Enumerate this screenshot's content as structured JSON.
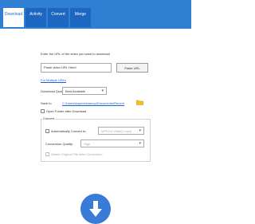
{
  "tabs": [
    "Download",
    "Activity",
    "Convert",
    "Merge"
  ],
  "form": {
    "url_label": "Enter the URL of the video you want to download",
    "url_value": "Paste video URL Here!",
    "paste_button": "Paste URL",
    "multiple_urls_link": "For Multiple URLs",
    "quality_label": "Download Quality",
    "quality_value": "Best Available",
    "save_label": "Save to",
    "save_path": "C:\\Users\\kapeeecsanup\\Documents\\Recerh",
    "open_folder_label": "Open Folder after Download"
  },
  "convert_group": {
    "title": "Convert",
    "auto_convert_label": "Automatically Convert to:",
    "format_value": "MPEG4 Video(*.mp4)",
    "quality_label": "Conversion Quality:",
    "quality_value": "High",
    "delete_original_label": "Delete Original File after Conversion"
  },
  "colors": {
    "accent": "#2f7fd3",
    "tab": "#1e67c1",
    "download_button": "#3a7bd8"
  },
  "icons": {
    "folder": "folder-icon",
    "download": "download-arrow-icon"
  }
}
